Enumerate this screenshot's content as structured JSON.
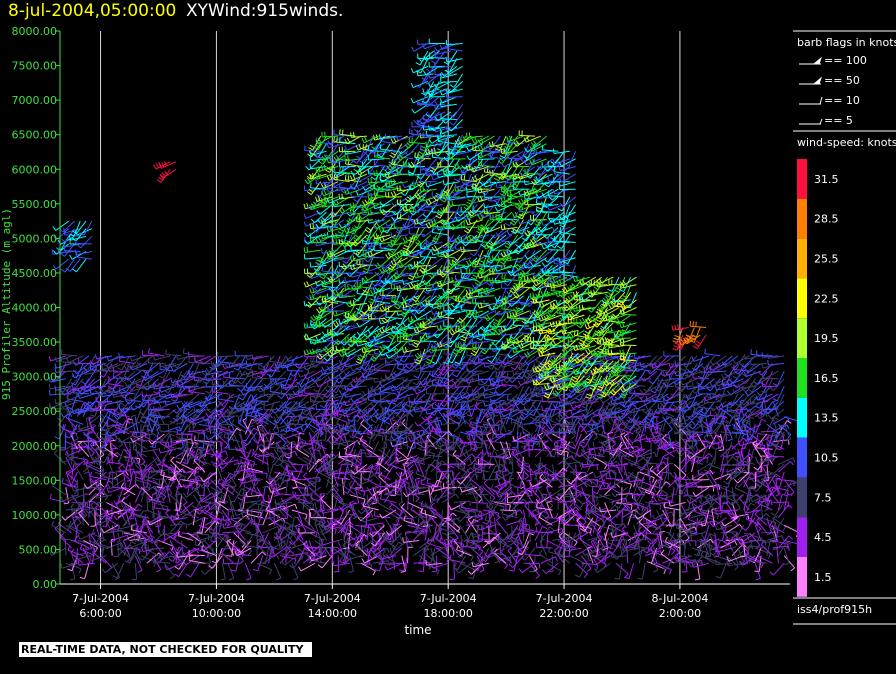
{
  "header": {
    "datetime": "8-jul-2004,05:00:00",
    "title": "XYWind:915winds."
  },
  "notice": "REAL-TIME DATA, NOT CHECKED FOR QUALITY",
  "legend": {
    "barb_title": "barb flags in knots",
    "barb_items": [
      "== 100",
      "== 50",
      "== 10",
      "== 5"
    ],
    "speed_title": "wind-speed: knots",
    "speed_labels": [
      "31.5",
      "28.5",
      "25.5",
      "22.5",
      "19.5",
      "16.5",
      "13.5",
      "10.5",
      "7.5",
      "4.5",
      "1.5"
    ],
    "speed_colors": [
      "#ff1040",
      "#ff8000",
      "#ffb000",
      "#ffff00",
      "#b0ff30",
      "#20e020",
      "#00ffff",
      "#4050ff",
      "#404070",
      "#a020f0",
      "#ff80ff"
    ],
    "source": "iss4/prof915h"
  },
  "chart_data": {
    "type": "scatter",
    "title": "",
    "xlabel": "time",
    "ylabel": "915 Profiler Altitude (m agl)",
    "ylim": [
      0,
      8000
    ],
    "yticks": [
      "0.00",
      "500.00",
      "1000.00",
      "1500.00",
      "2000.00",
      "2500.00",
      "3000.00",
      "3500.00",
      "4000.00",
      "4500.00",
      "5000.00",
      "5500.00",
      "6000.00",
      "6500.00",
      "7000.00",
      "7500.00",
      "8000.00"
    ],
    "xlim_hours": [
      4.6,
      29.8
    ],
    "xticks": [
      {
        "hour": 6,
        "date": "7-Jul-2004",
        "time": "6:00:00"
      },
      {
        "hour": 10,
        "date": "7-Jul-2004",
        "time": "10:00:00"
      },
      {
        "hour": 14,
        "date": "7-Jul-2004",
        "time": "14:00:00"
      },
      {
        "hour": 18,
        "date": "7-Jul-2004",
        "time": "18:00:00"
      },
      {
        "hour": 22,
        "date": "7-Jul-2004",
        "time": "22:00:00"
      },
      {
        "hour": 26,
        "date": "8-Jul-2004",
        "time": "2:00:00"
      }
    ],
    "grid": "vertical",
    "regions": [
      {
        "t0": 4.8,
        "t1": 29.6,
        "a0": 300,
        "a1": 2200,
        "s0": 2,
        "s1": 9
      },
      {
        "t0": 4.8,
        "t1": 29.6,
        "a0": 2200,
        "a1": 3400,
        "s0": 5,
        "s1": 12
      },
      {
        "t0": 13.6,
        "t1": 21.5,
        "a0": 3400,
        "a1": 6500,
        "s0": 9,
        "s1": 20
      },
      {
        "t0": 17.3,
        "t1": 18.6,
        "a0": 6500,
        "a1": 7900,
        "s0": 10,
        "s1": 15
      },
      {
        "t0": 21.5,
        "t1": 24.6,
        "a0": 2900,
        "a1": 4500,
        "s0": 14,
        "s1": 23
      },
      {
        "t0": 21.6,
        "t1": 22.4,
        "a0": 4500,
        "a1": 6300,
        "s0": 11,
        "s1": 14
      },
      {
        "t0": 26.1,
        "t1": 26.9,
        "a0": 3600,
        "a1": 3800,
        "s0": 29,
        "s1": 31
      },
      {
        "t0": 8.4,
        "t1": 8.6,
        "a0": 6000,
        "a1": 6200,
        "s0": 30,
        "s1": 32
      },
      {
        "t0": 4.9,
        "t1": 5.8,
        "a0": 4700,
        "a1": 5300,
        "s0": 10,
        "s1": 13
      }
    ]
  }
}
